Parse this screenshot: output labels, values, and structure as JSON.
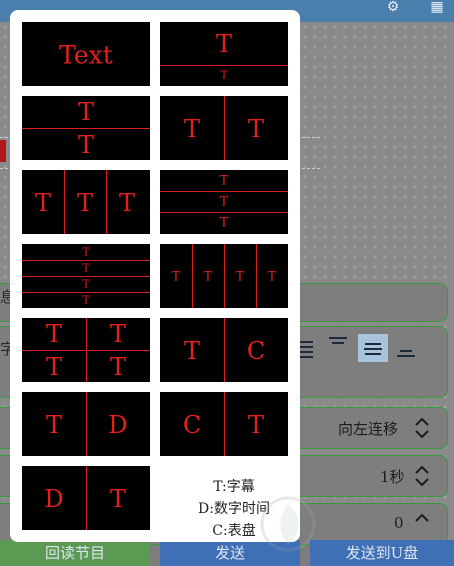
{
  "background": {
    "labels": {
      "partial_1": "息",
      "partial_2": "字",
      "scroll_mode": "向左连移",
      "duration": "1秒",
      "number": "0"
    },
    "buttons": {
      "read_program": "回读节目",
      "send": "发送",
      "send_usb": "发送到U盘"
    }
  },
  "layouts": [
    {
      "id": "l1",
      "label": "Text"
    },
    {
      "id": "l2",
      "labels": [
        "T",
        "T"
      ]
    },
    {
      "id": "l3",
      "labels": [
        "T",
        "T"
      ]
    },
    {
      "id": "l4",
      "labels": [
        "T",
        "T"
      ]
    },
    {
      "id": "l5",
      "labels": [
        "T",
        "T",
        "T"
      ]
    },
    {
      "id": "l6",
      "labels": [
        "T",
        "T",
        "T"
      ]
    },
    {
      "id": "l7",
      "labels": [
        "T",
        "T",
        "T",
        "T"
      ]
    },
    {
      "id": "l8",
      "labels": [
        "T",
        "T",
        "T",
        "T"
      ]
    },
    {
      "id": "l9",
      "labels": [
        "T",
        "T",
        "T",
        "T"
      ]
    },
    {
      "id": "l10",
      "labels": [
        "T",
        "C"
      ]
    },
    {
      "id": "l11",
      "labels": [
        "T",
        "D"
      ]
    },
    {
      "id": "l12",
      "labels": [
        "C",
        "T"
      ]
    },
    {
      "id": "l13",
      "labels": [
        "D",
        "T"
      ]
    }
  ],
  "legend": {
    "line1": "T:字幕",
    "line2": "D:数字时间",
    "line3": "C:表盘"
  },
  "colors": {
    "tile_bg": "#000000",
    "accent_red": "#e3201b",
    "dialog_bg": "#ffffff",
    "field_border": "#3a9a3a"
  }
}
